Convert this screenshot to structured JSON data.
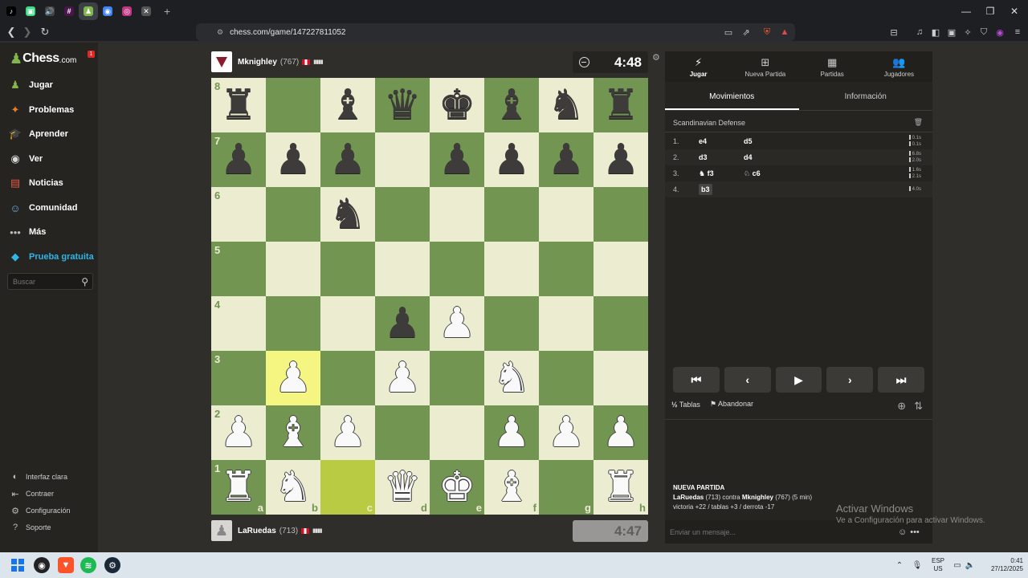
{
  "browser": {
    "tabs": [
      {
        "name": "tiktok",
        "glyph": "♪",
        "color": "#000000"
      },
      {
        "name": "android",
        "glyph": "▣",
        "color": "#3ddc84"
      },
      {
        "name": "audio",
        "glyph": "🔊",
        "color": "#444444"
      },
      {
        "name": "slack",
        "glyph": "#",
        "color": "#4a154b"
      },
      {
        "name": "chess",
        "glyph": "♟",
        "color": "#81b64c",
        "active": true
      },
      {
        "name": "chrome",
        "glyph": "◉",
        "color": "#4285f4"
      },
      {
        "name": "instagram",
        "glyph": "◎",
        "color": "#c13584"
      },
      {
        "name": "muted",
        "glyph": "✕",
        "color": "#555555"
      }
    ],
    "new_tab": "+",
    "url": "chess.com/game/147227811052",
    "badge_count": "1"
  },
  "sidebar": {
    "logo_name": "Chess",
    "logo_domain": ".com",
    "notif_count": "1",
    "items": [
      {
        "label": "Jugar",
        "icon": "play-board-icon",
        "glyph": "♟",
        "color": "#81b64c"
      },
      {
        "label": "Problemas",
        "icon": "puzzle-icon",
        "glyph": "✦",
        "color": "#e67e22"
      },
      {
        "label": "Aprender",
        "icon": "learn-icon",
        "glyph": "🎓",
        "color": "#3a9bd9"
      },
      {
        "label": "Ver",
        "icon": "binoculars-icon",
        "glyph": "◉",
        "color": "#d9d9d9"
      },
      {
        "label": "Noticias",
        "icon": "news-icon",
        "glyph": "▤",
        "color": "#e05a47"
      },
      {
        "label": "Comunidad",
        "icon": "community-icon",
        "glyph": "☺",
        "color": "#6ab0de"
      },
      {
        "label": "Más",
        "icon": "more-icon",
        "glyph": "•••",
        "color": "#bbbbbb"
      },
      {
        "label": "Prueba gratuita",
        "icon": "diamond-icon",
        "glyph": "◆",
        "color": "#2fb5e8",
        "accent": "#2fb5e8"
      }
    ],
    "search_placeholder": "Buscar",
    "bottom": [
      {
        "label": "Interfaz clara",
        "glyph": "◐"
      },
      {
        "label": "Contraer",
        "glyph": "⇤"
      },
      {
        "label": "Configuración",
        "glyph": "⚙"
      },
      {
        "label": "Soporte",
        "glyph": "?"
      }
    ]
  },
  "top_player": {
    "name": "Mknighley",
    "rating": "(767)",
    "clock": "4:48",
    "bars": "▮▮▮▮"
  },
  "bottom_player": {
    "name": "LaRuedas",
    "rating": "(713)",
    "clock": "4:47",
    "bars": "▮▮▮▮"
  },
  "board": {
    "ranks": [
      "8",
      "7",
      "6",
      "5",
      "4",
      "3",
      "2",
      "1"
    ],
    "files": [
      "a",
      "b",
      "c",
      "d",
      "e",
      "f",
      "g",
      "h"
    ],
    "position": [
      [
        "bR",
        "",
        "bB",
        "bQ",
        "bK",
        "bB",
        "bN",
        "bR"
      ],
      [
        "bP",
        "bP",
        "bP",
        "",
        "bP",
        "bP",
        "bP",
        "bP"
      ],
      [
        "",
        "",
        "bN",
        "",
        "",
        "",
        "",
        ""
      ],
      [
        "",
        "",
        "",
        "",
        "",
        "",
        "",
        ""
      ],
      [
        "",
        "",
        "",
        "bP",
        "wP",
        "",
        "",
        ""
      ],
      [
        "",
        "wP",
        "",
        "wP",
        "",
        "wN",
        "",
        ""
      ],
      [
        "wP",
        "wB",
        "wP",
        "",
        "",
        "wP",
        "wP",
        "wP"
      ],
      [
        "wR",
        "wN",
        "",
        "wQ",
        "wK",
        "wB",
        "",
        "wR"
      ]
    ],
    "highlights": [
      "b3",
      "c1"
    ]
  },
  "panel": {
    "tabs": [
      {
        "label": "Jugar",
        "glyph": "⚡",
        "active": true
      },
      {
        "label": "Nueva Partida",
        "glyph": "⊞"
      },
      {
        "label": "Partidas",
        "glyph": "▦"
      },
      {
        "label": "Jugadores",
        "glyph": "👥"
      }
    ],
    "subtabs": [
      "Movimientos",
      "Información"
    ],
    "opening": "Scandinavian Defense",
    "moves": [
      {
        "num": "1.",
        "white": "e4",
        "black": "d5",
        "times": [
          "0.1s",
          "0.1s"
        ]
      },
      {
        "num": "2.",
        "white": "d3",
        "black": "d4",
        "times": [
          "6.8s",
          "2.0s"
        ]
      },
      {
        "num": "3.",
        "white": "♞ f3",
        "black": "♘ c6",
        "times": [
          "1.6s",
          "2.1s"
        ]
      },
      {
        "num": "4.",
        "white": "b3",
        "black": "",
        "times": [
          "4.0s"
        ]
      }
    ],
    "controls": [
      "⏮",
      "‹",
      "▶",
      "›",
      "⏭"
    ],
    "draw_label": "Tablas",
    "draw_prefix": "½",
    "resign_label": "Abandonar",
    "new_game_title": "NUEVA PARTIDA",
    "new_game_white": "LaRuedas",
    "new_game_white_rating": "(713)",
    "new_game_vs": "contra",
    "new_game_black": "Mknighley",
    "new_game_black_rating": "(767)",
    "new_game_time": "(5 min)",
    "new_game_stats": "victoria +22 / tablas +3 / derrota -17",
    "chat_placeholder": "Enviar un mensaje..."
  },
  "watermark": {
    "line1": "Activar Windows",
    "line2": "Ve a Configuración para activar Windows."
  },
  "taskbar": {
    "lang1": "ESP",
    "lang2": "US",
    "time": "0:41",
    "date": "27/12/2025"
  }
}
